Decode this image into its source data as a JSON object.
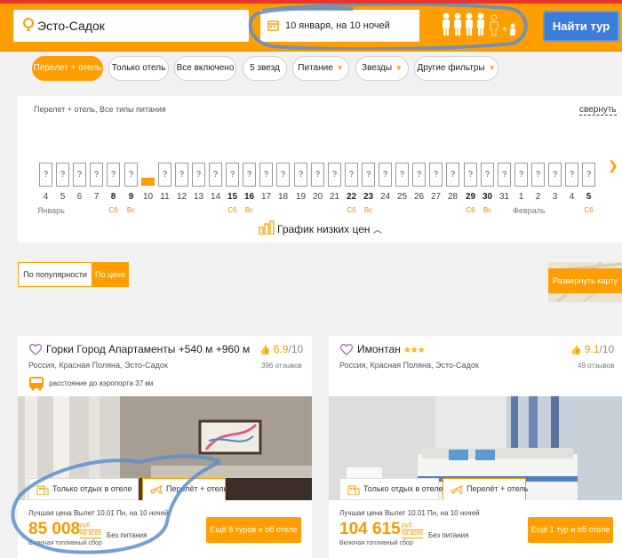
{
  "search": {
    "destination": "Эсто-Садок",
    "dates": "10 января, на 10 ночей",
    "button": "Найти тур"
  },
  "filters": [
    {
      "label": "Перелет + отель",
      "active": true
    },
    {
      "label": "Только отель"
    },
    {
      "label": "Все включено"
    },
    {
      "label": "5 звезд"
    },
    {
      "label": "Питание",
      "dropdown": true
    },
    {
      "label": "Звезды",
      "dropdown": true
    },
    {
      "label": "Другие фильтры",
      "dropdown": true
    }
  ],
  "calendar": {
    "title": "Перелет + отель, Все типы питания",
    "collapse": "свернуть",
    "chart_label": "График низких цен",
    "days": [
      {
        "d": "4",
        "m": "Январь"
      },
      {
        "d": "5"
      },
      {
        "d": "6"
      },
      {
        "d": "7"
      },
      {
        "d": "8",
        "w": "Сб",
        "b": true
      },
      {
        "d": "9",
        "w": "Вс",
        "b": true
      },
      {
        "d": "10",
        "sel": true
      },
      {
        "d": "11"
      },
      {
        "d": "12"
      },
      {
        "d": "13"
      },
      {
        "d": "14"
      },
      {
        "d": "15",
        "w": "Сб",
        "b": true
      },
      {
        "d": "16",
        "w": "Вс",
        "b": true
      },
      {
        "d": "17"
      },
      {
        "d": "18"
      },
      {
        "d": "19"
      },
      {
        "d": "20"
      },
      {
        "d": "21"
      },
      {
        "d": "22",
        "w": "Сб",
        "b": true
      },
      {
        "d": "23",
        "w": "Вс",
        "b": true
      },
      {
        "d": "24"
      },
      {
        "d": "25"
      },
      {
        "d": "26"
      },
      {
        "d": "27"
      },
      {
        "d": "28"
      },
      {
        "d": "29",
        "w": "Сб",
        "b": true
      },
      {
        "d": "30",
        "w": "Вс",
        "b": true
      },
      {
        "d": "31"
      },
      {
        "d": "1",
        "m": "Февраль"
      },
      {
        "d": "2"
      },
      {
        "d": "3"
      },
      {
        "d": "4"
      },
      {
        "d": "5",
        "w": "Сб",
        "b": true
      }
    ],
    "unknown_price": "?"
  },
  "sort": {
    "popular": "По популярности",
    "price": "По цене"
  },
  "map": {
    "button": "Развернуть карту"
  },
  "hotels": [
    {
      "name": "Горки Город Апартаменты +540 м +960 м",
      "location": "Россия, Красная Поляна, Эсто-Садок",
      "rating": "6.9",
      "rating_max": "/10",
      "reviews": "396 отзывов",
      "airport": "расстояние до аэропорта 37 км",
      "tab_hotel": "Только отдых в отеле",
      "tab_flight": "Перелёт + отель",
      "best_label": "Лучшая цена Вылет 10.01 Пн, на 10 ночей",
      "price": "85 008",
      "cur1": "руб",
      "cur2": "на всех",
      "meal": "Без питания",
      "fuel": "Включая топливный сбор",
      "more": "Ещё 8 туров и об отеле"
    },
    {
      "name": "Имонтан",
      "stars": "★★★",
      "location": "Россия, Красная Поляна, Эсто-Садок",
      "rating": "9.1",
      "rating_max": "/10",
      "reviews": "49 отзывов",
      "tab_hotel": "Только отдых в отеле",
      "tab_flight": "Перелёт + отель",
      "best_label": "Лучшая цена Вылет 10.01 Пн, на 10 ночей",
      "price": "104 615",
      "cur1": "руб",
      "cur2": "на всех",
      "meal": "Без питания",
      "fuel": "Включая топливный сбор",
      "more": "Ещё 1 тур и об отеле"
    }
  ],
  "colors": {
    "accent": "#ff9e00",
    "button": "#3b7dd8",
    "scribble": "#5b8fd0"
  }
}
